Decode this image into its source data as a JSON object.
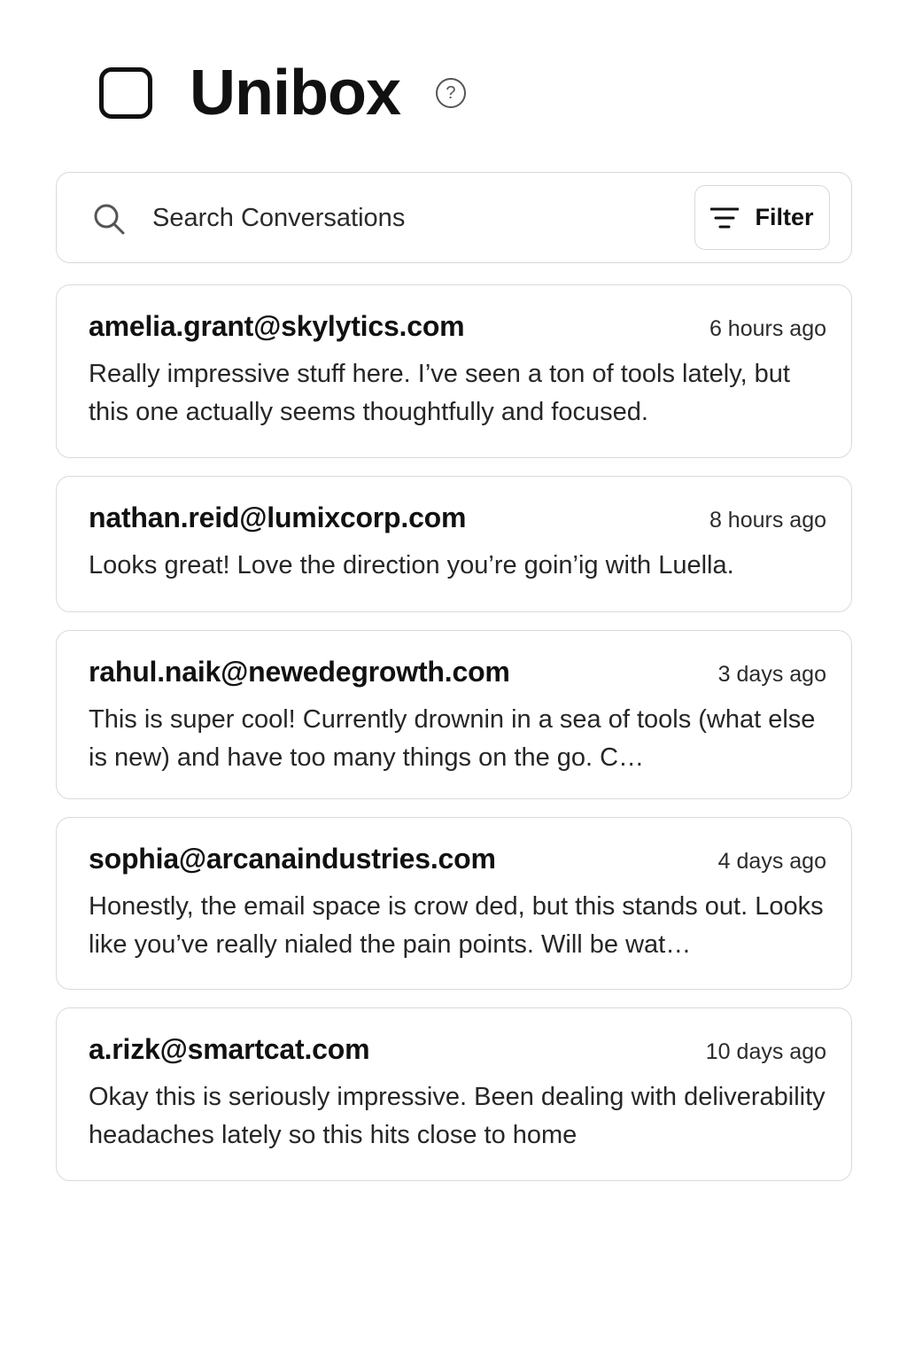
{
  "header": {
    "title": "Unibox",
    "help_glyph": "?",
    "logo_icon": "checkbox-square-icon"
  },
  "search": {
    "placeholder": "Search Conversations",
    "value": "",
    "icon": "search-icon"
  },
  "filter": {
    "label": "Filter",
    "icon": "filter-lines-icon"
  },
  "conversations": [
    {
      "sender": "amelia.grant@skylytics.com",
      "time": "6 hours ago",
      "preview": "Really impressive stuff here. I’ve seen a ton of tools lately, but this one actually seems thoughtfully and focused."
    },
    {
      "sender": "nathan.reid@lumixcorp.com",
      "time": "8 hours ago",
      "preview": "Looks great! Love the direction you’re goin’ig with Luella."
    },
    {
      "sender": "rahul.naik@newedegrowth.com",
      "time": "3 days ago",
      "preview": "This is super cool! Currently drownin in a sea of tools (what else is new) and have too many things on the go. C…"
    },
    {
      "sender": "sophia@arcanaindustries.com",
      "time": "4 days ago",
      "preview": "Honestly, the email space is crow ded, but this stands out. Looks like you’ve really nialed the pain points. Will be wat…"
    },
    {
      "sender": "a.rizk@smartcat.com",
      "time": "10 days ago",
      "preview": "Okay this is seriously impressive. Been dealing with deliverability headaches lately so this hits close to home"
    }
  ],
  "colors": {
    "border": "#dadada",
    "text": "#111111",
    "muted": "#2b2b2b"
  }
}
